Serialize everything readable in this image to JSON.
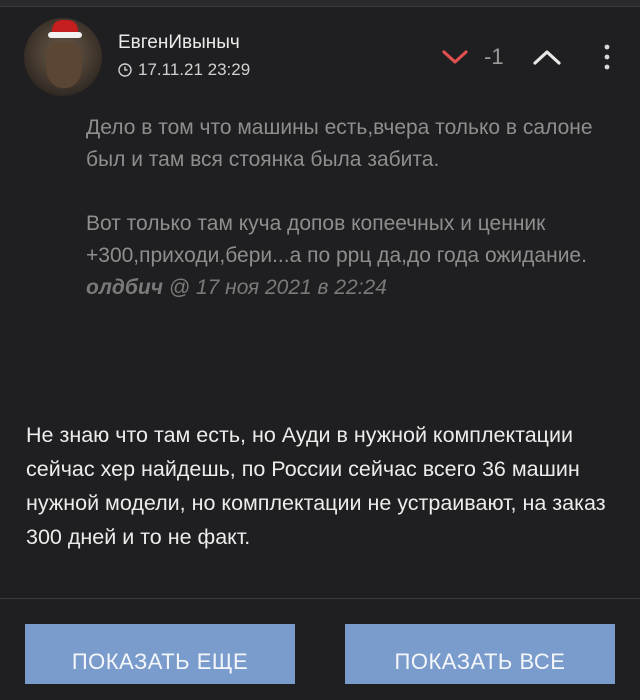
{
  "comment": {
    "author": "ЕвгенИвыныч",
    "date": "17.11.21 23:29",
    "score": "-1",
    "quote": {
      "paragraphs": [
        "Дело в том что машины есть,вчера только в салоне был и там вся стоянка была забита.",
        "Вот только там куча допов копеечных и ценник +300,приходи,бери...а по ррц да,до года ожидание."
      ],
      "cite_author": "олдбич",
      "cite_at": "@",
      "cite_date": "17 ноя 2021 в 22:24"
    },
    "text": "Не знаю что там есть, но Ауди в нужной комплектации сейчас хер найдешь, по России сейчас всего 36 машин нужной модели, но комплектации не устраивают, на заказ 300 дней и то не факт."
  },
  "buttons": {
    "show_more": "ПОКАЗАТЬ ЕЩЕ",
    "show_all": "ПОКАЗАТЬ ВСЕ"
  },
  "colors": {
    "background": "#1f1f21",
    "downvote": "#e0504e",
    "button": "#7a9ccc"
  },
  "icons": [
    "clock-icon",
    "chevron-down-icon",
    "chevron-up-icon",
    "more-vertical-icon"
  ]
}
